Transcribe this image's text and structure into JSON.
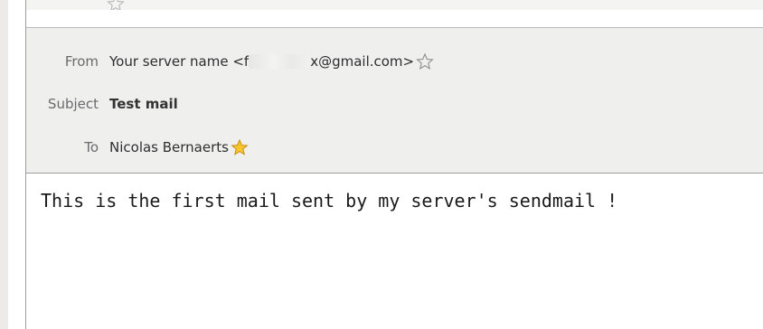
{
  "message_header": {
    "from_label": "From",
    "from_value_prefix": "Your server name <f",
    "from_value_suffix": "x@gmail.com>",
    "subject_label": "Subject",
    "subject_value": "Test mail",
    "to_label": "To",
    "to_value": "Nicolas Bernaerts"
  },
  "message_body": {
    "text": "This is the first mail sent by my server's sendmail !"
  },
  "icons": {
    "top_star": "star-outline-icon",
    "from_star": "star-outline-icon",
    "to_star": "star-filled-icon"
  },
  "colors": {
    "star_filled": "#f7c62f",
    "star_outline": "#9a9a9a",
    "header_bg": "#efefee"
  }
}
